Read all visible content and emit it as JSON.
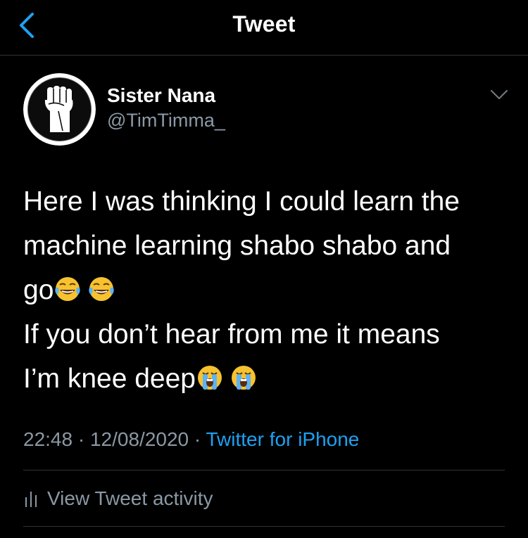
{
  "header": {
    "title": "Tweet",
    "back_icon": "chevron-left-icon"
  },
  "author": {
    "display_name": "Sister Nana",
    "handle": "@TimTimma_",
    "avatar_icon": "raised-fist-avatar"
  },
  "tweet": {
    "lines": [
      "Here I was thinking I could learn the",
      "machine learning shabo shabo and",
      "go",
      "If you don’t hear from me it means",
      "I’m knee deep"
    ],
    "emojis": {
      "line3": [
        "face-with-tears-of-joy",
        "face-with-tears-of-joy"
      ],
      "line5": [
        "loudly-crying-face",
        "loudly-crying-face"
      ]
    }
  },
  "meta": {
    "time": "22:48",
    "separator": " · ",
    "date": "12/08/2020",
    "source": "Twitter for iPhone"
  },
  "activity": {
    "label": "View Tweet activity",
    "icon": "bar-chart-icon"
  },
  "colors": {
    "background": "#000000",
    "accent": "#1da1f2",
    "secondary_text": "#8b98a5",
    "divider": "#2f3336"
  }
}
